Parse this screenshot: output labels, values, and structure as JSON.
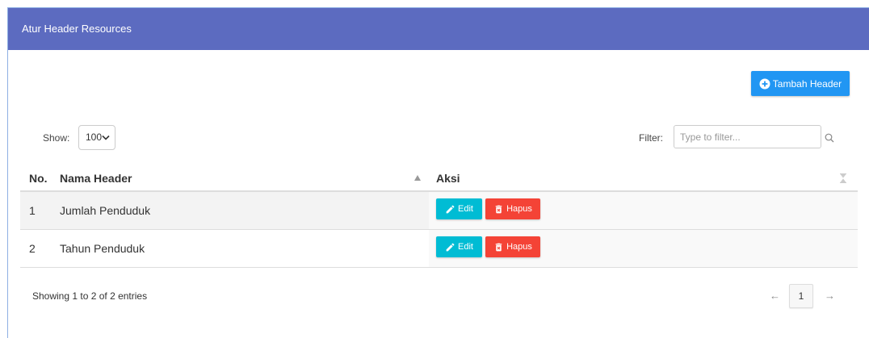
{
  "card": {
    "title": "Atur Header Resources"
  },
  "toolbar": {
    "add_label": "Tambah Header",
    "add_icon": "plus-circle-icon"
  },
  "length_menu": {
    "label": "Show:",
    "selected": "100",
    "icon": "chevron-down-icon"
  },
  "filter": {
    "label": "Filter:",
    "placeholder": "Type to filter...",
    "icon": "search-icon"
  },
  "table": {
    "columns": [
      {
        "label": "No."
      },
      {
        "label": "Nama Header",
        "sort_icon": "sort-asc-icon"
      },
      {
        "label": "Aksi",
        "sort_icon": "sort-both-icon"
      }
    ],
    "rows": [
      {
        "no": "1",
        "nama_header": "Jumlah Penduduk",
        "actions": {
          "edit": "Edit",
          "delete": "Hapus"
        }
      },
      {
        "no": "2",
        "nama_header": "Tahun Penduduk",
        "actions": {
          "edit": "Edit",
          "delete": "Hapus"
        }
      }
    ],
    "action_icons": {
      "edit": "pencil-icon",
      "delete": "trash-icon"
    }
  },
  "info": "Showing 1 to 2 of 2 entries",
  "pagination": {
    "previous": "←",
    "current_page": "1",
    "next": "→"
  },
  "colors": {
    "header": "#5c6bc0",
    "primary": "#2196f3",
    "edit": "#00bcd4",
    "delete": "#f44336"
  }
}
